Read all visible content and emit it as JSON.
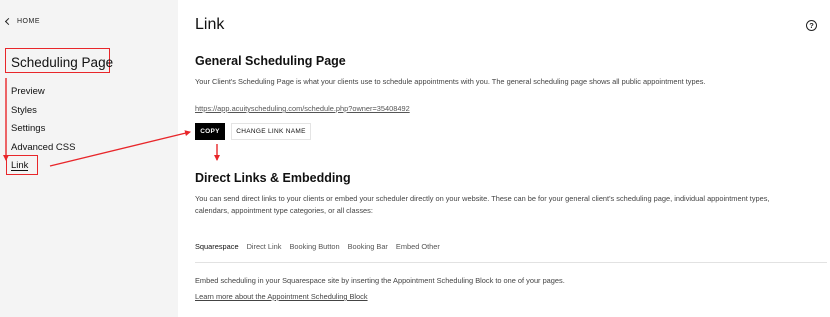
{
  "sidebar": {
    "home_label": "HOME",
    "title": "Scheduling Page",
    "items": [
      {
        "label": "Preview"
      },
      {
        "label": "Styles"
      },
      {
        "label": "Settings"
      },
      {
        "label": "Advanced CSS"
      },
      {
        "label": "Link"
      }
    ]
  },
  "main": {
    "title": "Link",
    "help_icon": "?",
    "general": {
      "heading": "General Scheduling Page",
      "description": "Your Client's Scheduling Page is what your clients use to schedule appointments with you. The general scheduling page shows all public appointment types.",
      "url": "https://app.acuityscheduling.com/schedule.php?owner=35408492",
      "copy_label": "COPY",
      "change_label": "CHANGE LINK NAME"
    },
    "direct": {
      "heading": "Direct Links & Embedding",
      "description_line1": "You can send direct links to your clients or embed your scheduler directly on your website. These can be for your general client's scheduling page, individual appointment types,",
      "description_line2": "calendars, appointment type categories, or all classes:",
      "tabs": [
        "Squarespace",
        "Direct Link",
        "Booking Button",
        "Booking Bar",
        "Embed Other"
      ],
      "active_tab": "Squarespace",
      "embed_text": "Embed scheduling in your Squarespace site by inserting the Appointment Scheduling Block to one of your pages.",
      "learn_link": "Learn more about the Appointment Scheduling Block"
    }
  },
  "annotation_color": "#e8262a"
}
